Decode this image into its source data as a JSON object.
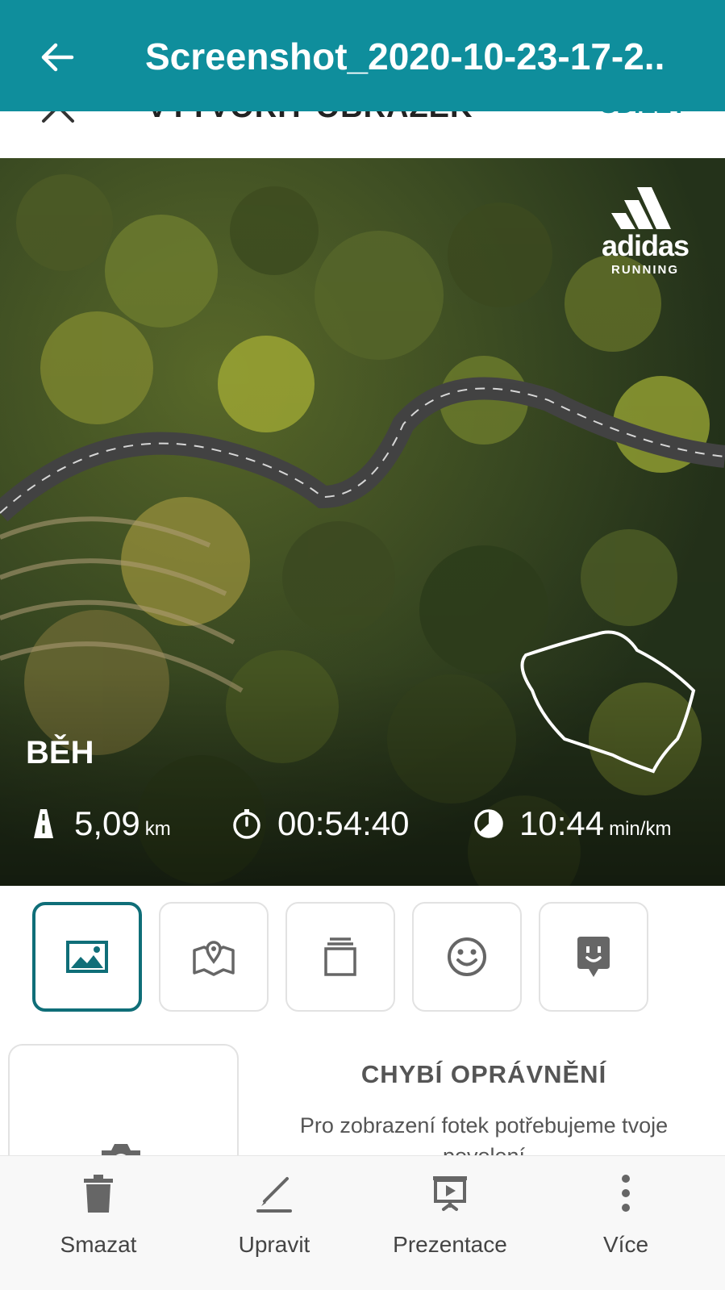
{
  "appbar": {
    "title": "Screenshot_2020-10-23-17-2..",
    "back_icon": "arrow-left-icon",
    "background": "#0f8e9c"
  },
  "editor": {
    "title": "VYTVOŘIT OBRÁZEK",
    "share": "SDÍLET"
  },
  "photo": {
    "brand": {
      "word": "adidas",
      "sub": "RUNNING"
    },
    "activity": "BĚH",
    "stats": [
      {
        "icon": "road-icon",
        "value": "5,09",
        "unit": "km"
      },
      {
        "icon": "stopwatch-icon",
        "value": "00:54:40",
        "unit": ""
      },
      {
        "icon": "pace-icon",
        "value": "10:44",
        "unit": "min/km"
      }
    ]
  },
  "tools": [
    {
      "icon": "image-icon",
      "active": true
    },
    {
      "icon": "map-pin-icon",
      "active": false
    },
    {
      "icon": "layers-icon",
      "active": false
    },
    {
      "icon": "smiley-icon",
      "active": false
    },
    {
      "icon": "sticker-icon",
      "active": false
    }
  ],
  "permission": {
    "title": "CHYBÍ OPRÁVNĚNÍ",
    "text": "Pro zobrazení fotek potřebujeme tvoje povolení"
  },
  "bottombar": {
    "actions": [
      {
        "label": "Smazat",
        "icon": "trash-icon"
      },
      {
        "label": "Upravit",
        "icon": "pencil-icon"
      },
      {
        "label": "Prezentace",
        "icon": "slideshow-icon"
      },
      {
        "label": "Více",
        "icon": "more-vert-icon"
      }
    ]
  },
  "colors": {
    "accent": "#0f8e9c",
    "active_border": "#0f6e78",
    "icon_gray": "#666666"
  }
}
